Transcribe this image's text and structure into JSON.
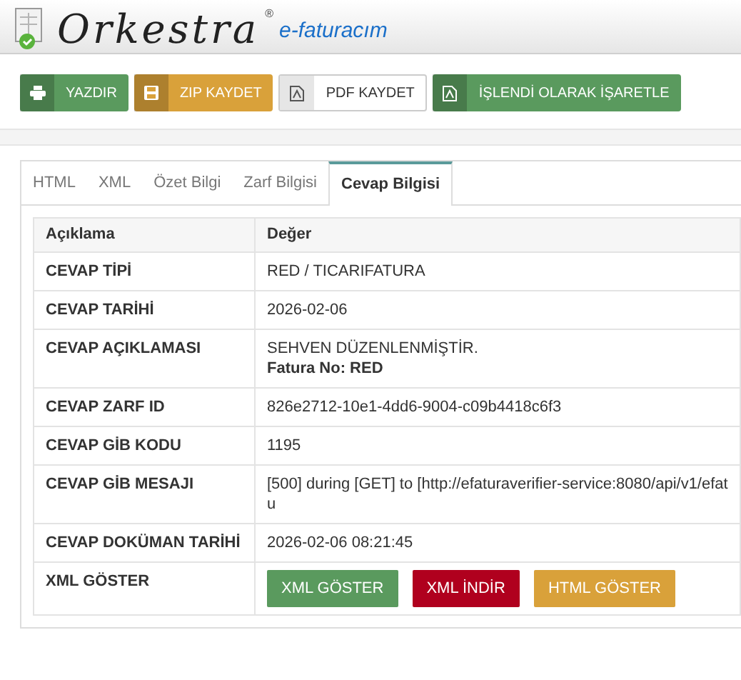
{
  "logo": {
    "name": "Orkestra",
    "mark": "®",
    "product": "e-faturacım"
  },
  "toolbar": [
    {
      "label": "YAZDIR",
      "kind": "print",
      "color": "#5a9a5e"
    },
    {
      "label": "ZIP KAYDET",
      "kind": "save",
      "color": "#d9a13a"
    },
    {
      "label": "PDF KAYDET",
      "kind": "pdf",
      "color": "#ffffff"
    },
    {
      "label": "İŞLENDİ OLARAK İŞARETLE",
      "kind": "pdf",
      "color": "#5a9a5e"
    }
  ],
  "tabs": [
    {
      "label": "HTML",
      "selected": false
    },
    {
      "label": "XML",
      "selected": false
    },
    {
      "label": "Özet Bilgi",
      "selected": false
    },
    {
      "label": "Zarf Bilgisi",
      "selected": false
    },
    {
      "label": "Cevap Bilgisi",
      "selected": true
    }
  ],
  "table": {
    "columns": [
      "Açıklama",
      "Değer"
    ],
    "rows": [
      {
        "label": "CEVAP TİPİ",
        "value": "RED / TICARIFATURA"
      },
      {
        "label": "CEVAP TARİHİ",
        "value": "2026-02-06"
      },
      {
        "label": "CEVAP AÇIKLAMASI",
        "value": "SEHVEN DÜZENLENMİŞTİR.",
        "note": "Fatura No: RED"
      },
      {
        "label": "CEVAP ZARF ID",
        "value": "826e2712-10e1-4dd6-9004-c09b4418c6f3"
      },
      {
        "label": "CEVAP GİB KODU",
        "value": "1195"
      },
      {
        "label": "CEVAP GİB MESAJI",
        "value": "[500] during [GET] to [http://efaturaverifier-service:8080/api/v1/efatu"
      },
      {
        "label": "CEVAP DOKÜMAN TARİHİ",
        "value": "2026-02-06 08:21:45"
      },
      {
        "label": "XML GÖSTER",
        "buttons": [
          {
            "label": "XML GÖSTER",
            "color": "#5a9a5e"
          },
          {
            "label": "XML İNDİR",
            "color": "#b0001e"
          },
          {
            "label": "HTML GÖSTER",
            "color": "#d9a13a"
          }
        ]
      }
    ]
  }
}
